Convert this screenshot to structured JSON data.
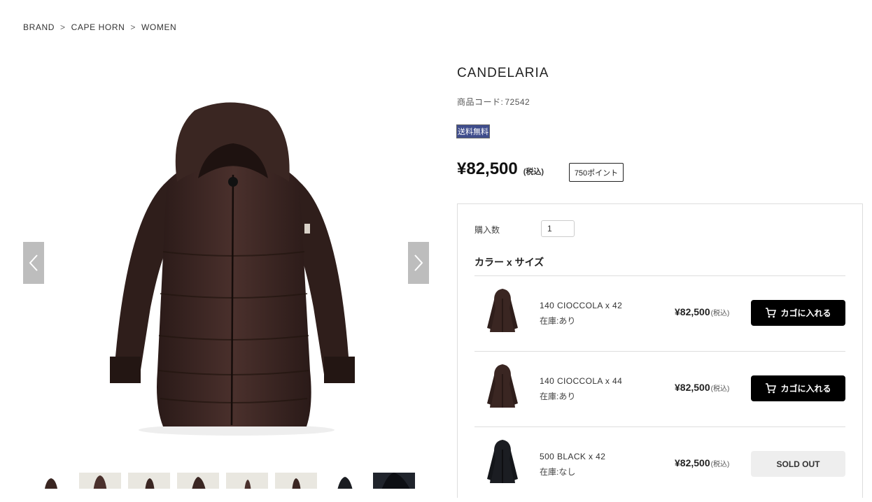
{
  "breadcrumb": {
    "items": [
      "BRAND",
      "CAPE HORN",
      "WOMEN"
    ],
    "separator": ">"
  },
  "product": {
    "name": "CANDELARIA",
    "code_label": "商品コード:",
    "code": "72542",
    "free_shipping": "送料無料",
    "price": "¥82,500",
    "tax_note": "(税込)",
    "points": "750ポイント",
    "quantity_label": "購入数",
    "quantity_value": "1",
    "variants_heading": "カラー x サイズ"
  },
  "variants": [
    {
      "name": "140 CIOCCOLA x 42",
      "stock": "在庫:あり",
      "price": "¥82,500",
      "tax": "(税込)",
      "button": "カゴに入れる",
      "color": "#3a2622"
    },
    {
      "name": "140 CIOCCOLA x 44",
      "stock": "在庫:あり",
      "price": "¥82,500",
      "tax": "(税込)",
      "button": "カゴに入れる",
      "color": "#3a2622"
    },
    {
      "name": "500 BLACK x 42",
      "stock": "在庫:なし",
      "price": "¥82,500",
      "tax": "(税込)",
      "button": "SOLD OUT",
      "color": "#1b1d22"
    }
  ],
  "colors": {
    "coat": "#3b2623",
    "button_dark": "#000000",
    "free_shipping_bg": "#3f4d8c",
    "arrow_bg": "#bdbdbd"
  },
  "icons": {
    "prev": "chevron-left-icon",
    "next": "chevron-right-icon",
    "cart": "cart-icon"
  }
}
